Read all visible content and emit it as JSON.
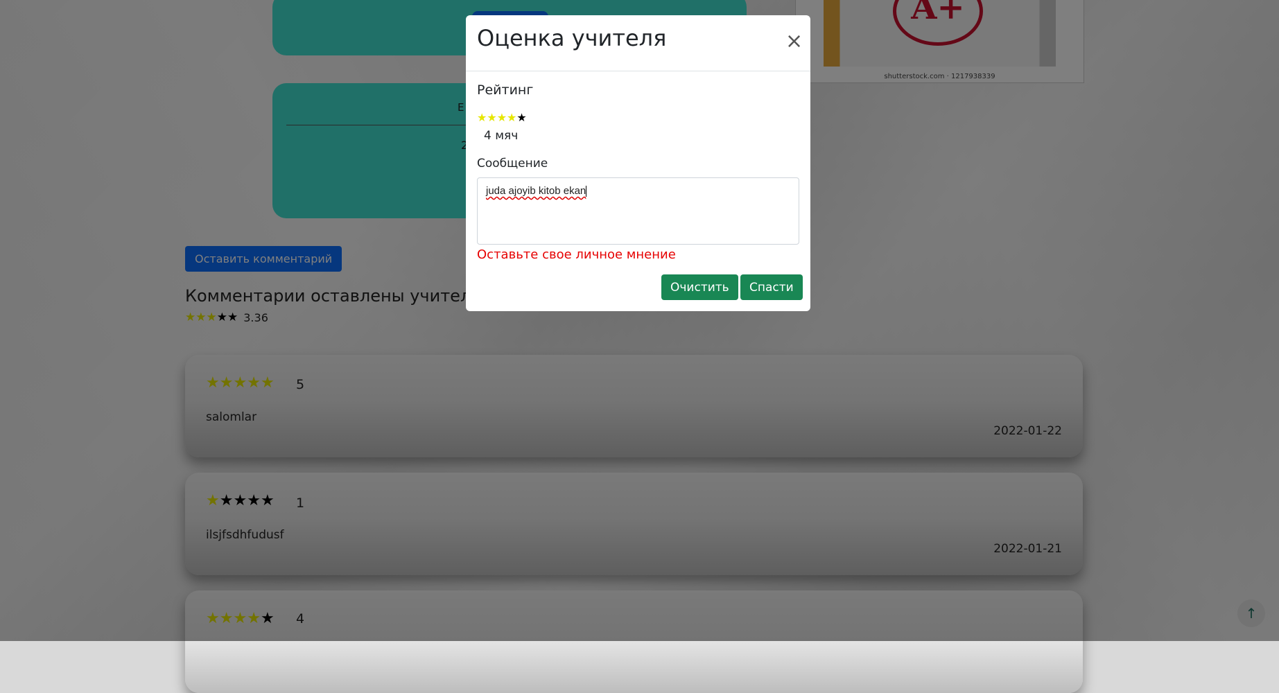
{
  "background_page": {
    "partial_card_title": "E",
    "partial_card_value": "2",
    "image_credit": "shutterstock.com · 1217938339",
    "image_grade": "A+",
    "comment_button": "Оставить комментарий",
    "section_title": "Комментарии оставлены учител",
    "average_rating": {
      "value": "3.36",
      "stars_filled": 3,
      "stars_total": 5
    },
    "reviews": [
      {
        "score": "5",
        "stars_filled": 5,
        "text": "salomlar",
        "date": "2022-01-22"
      },
      {
        "score": "1",
        "stars_filled": 1,
        "text": "ilsjfsdhfudusf",
        "date": "2022-01-21"
      },
      {
        "score": "4",
        "stars_filled": 4,
        "text": "",
        "date": ""
      }
    ],
    "scroll_top_icon": "arrow-up-icon"
  },
  "modal": {
    "title": "Оценка учителя",
    "close_icon": "close-icon",
    "rating_label": "Рейтинг",
    "rating": {
      "stars_filled": 4,
      "stars_total": 5,
      "caption": "4 мяч"
    },
    "message_label": "Сообщение",
    "message_value": "juda ajoyib kitob ekan",
    "error_text": "Оставьте свое личное мнение",
    "clear_button": "Очистить",
    "save_button": "Спасти"
  },
  "colors": {
    "star_on": "#e6e600",
    "star_off": "#000000",
    "primary": "#0d6efd",
    "success": "#198754",
    "error": "#e60000",
    "teal": "#40e0d0"
  }
}
